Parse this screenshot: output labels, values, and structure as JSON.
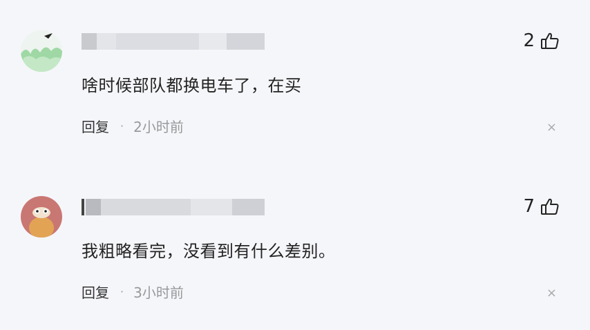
{
  "comments": [
    {
      "text": "啥时候部队都换电车了，在买",
      "reply_label": "回复",
      "separator": "·",
      "time": "2小时前",
      "likes": "2",
      "close_symbol": "×",
      "avatar_colors": {
        "top": "#eef4ef",
        "bottom": "#9fd8a5"
      }
    },
    {
      "text": "我粗略看完，没看到有什么差别。",
      "reply_label": "回复",
      "separator": "·",
      "time": "3小时前",
      "likes": "7",
      "close_symbol": "×",
      "avatar_colors": {
        "top": "#c97773",
        "bottom": "#e2a454"
      }
    }
  ],
  "icons": {
    "like": "thumbs-up-icon",
    "close": "close-icon"
  }
}
